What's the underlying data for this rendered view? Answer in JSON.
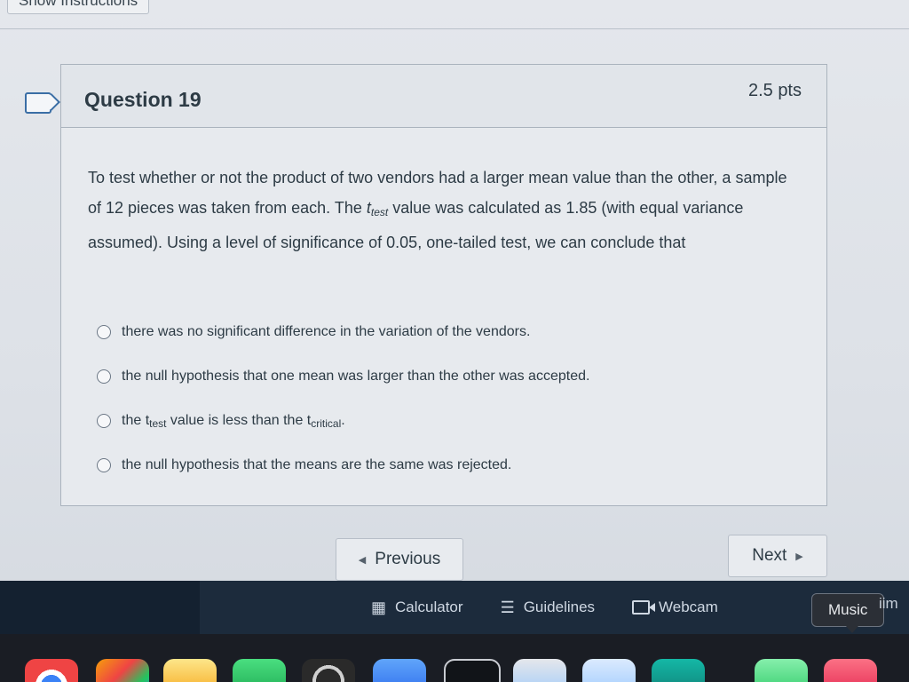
{
  "header": {
    "show_instructions_label": "Show Instructions"
  },
  "question": {
    "title": "Question 19",
    "points": "2.5 pts",
    "prompt": {
      "part1": "To test whether or not the product of two vendors had a larger mean value than the other, a sample of 12 pieces was taken from each. The ",
      "t_symbol": "t",
      "t_subscript": "test",
      "part2": " value was calculated as 1.85 (with equal variance assumed). Using a level of significance of 0.05, one-tailed test, we can conclude that"
    },
    "answers": [
      {
        "text": "there was no significant difference in the variation of the vendors."
      },
      {
        "text": "the null hypothesis that one mean was larger than the other was accepted."
      },
      {
        "prefix": "the t",
        "sub1": "test",
        "middle": " value is less than the t",
        "sub2": "critical",
        "suffix": "."
      },
      {
        "text": "the null hypothesis that the means are the same was rejected."
      }
    ]
  },
  "navigation": {
    "previous_label": "Previous",
    "next_label": "Next",
    "previous_icon": "left-caret",
    "next_icon": "right-caret"
  },
  "toolbar": {
    "calculator_label": "Calculator",
    "guidelines_label": "Guidelines",
    "webcam_label": "Webcam",
    "music_label": "Music",
    "edge_text": "iim"
  },
  "colors": {
    "toolbar_bg": "#1c2b3c",
    "accent": "#3a6ea5"
  }
}
